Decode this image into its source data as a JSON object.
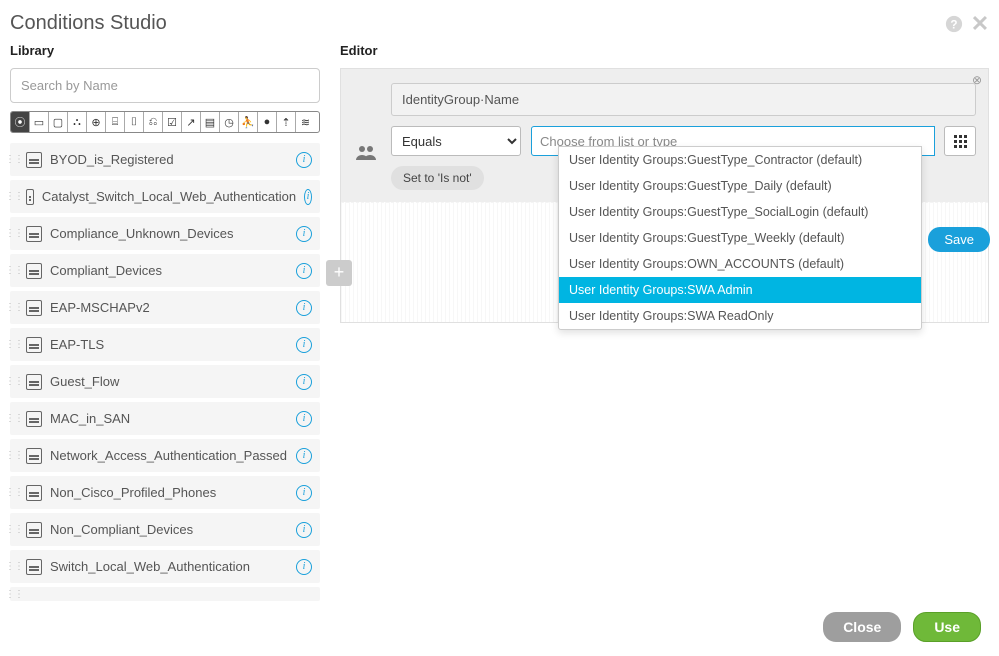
{
  "title": "Conditions Studio",
  "library": {
    "title": "Library",
    "search_placeholder": "Search by Name",
    "items": [
      {
        "label": "BYOD_is_Registered"
      },
      {
        "label": "Catalyst_Switch_Local_Web_Authentication"
      },
      {
        "label": "Compliance_Unknown_Devices"
      },
      {
        "label": "Compliant_Devices"
      },
      {
        "label": "EAP-MSCHAPv2"
      },
      {
        "label": "EAP-TLS"
      },
      {
        "label": "Guest_Flow"
      },
      {
        "label": "MAC_in_SAN"
      },
      {
        "label": "Network_Access_Authentication_Passed"
      },
      {
        "label": "Non_Cisco_Profiled_Phones"
      },
      {
        "label": "Non_Compliant_Devices"
      },
      {
        "label": "Switch_Local_Web_Authentication"
      }
    ]
  },
  "editor": {
    "title": "Editor",
    "attribute": "IdentityGroup·Name",
    "operator": "Equals",
    "value_placeholder": "Choose from list or type",
    "set_not": "Set to 'Is not'",
    "save": "Save",
    "dropdown": [
      {
        "label": "User Identity Groups:GuestType_Contractor (default)",
        "selected": false
      },
      {
        "label": "User Identity Groups:GuestType_Daily (default)",
        "selected": false
      },
      {
        "label": "User Identity Groups:GuestType_SocialLogin (default)",
        "selected": false
      },
      {
        "label": "User Identity Groups:GuestType_Weekly (default)",
        "selected": false
      },
      {
        "label": "User Identity Groups:OWN_ACCOUNTS (default)",
        "selected": false
      },
      {
        "label": "User Identity Groups:SWA Admin",
        "selected": true
      },
      {
        "label": "User Identity Groups:SWA ReadOnly",
        "selected": false
      }
    ]
  },
  "footer": {
    "close": "Close",
    "use": "Use"
  }
}
